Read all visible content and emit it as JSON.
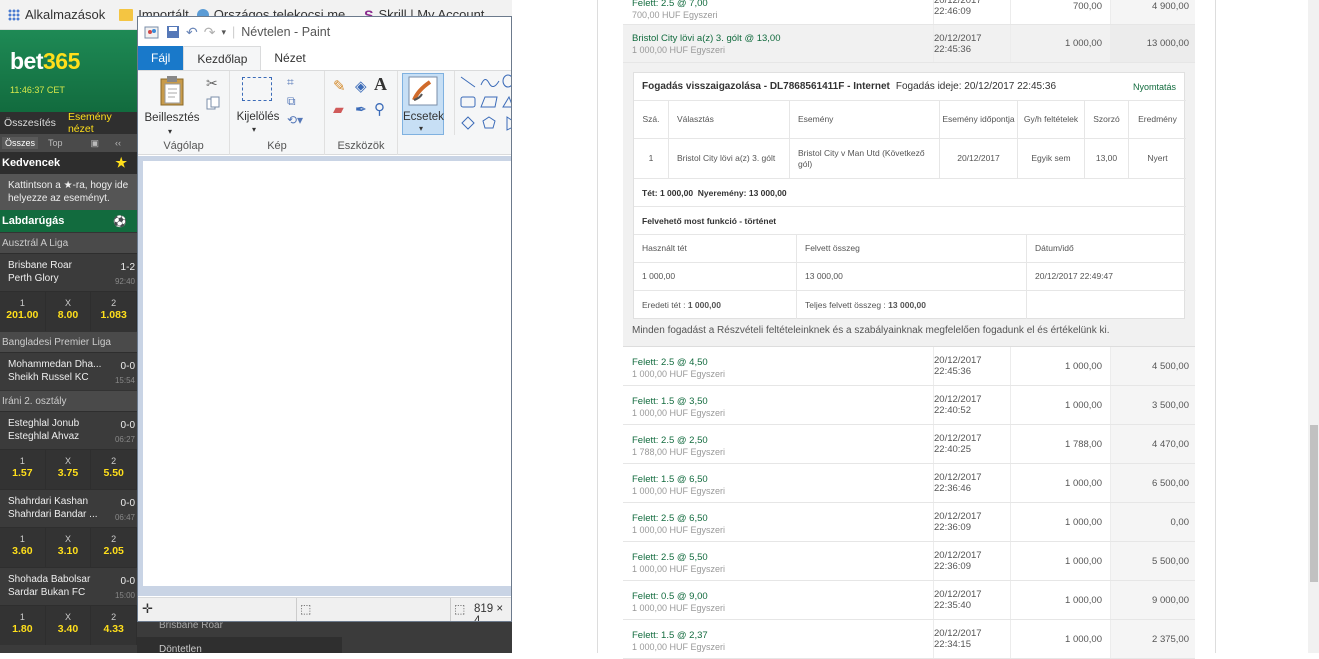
{
  "bookmarks": {
    "apps_label": "Alkalmazások",
    "items": [
      "Importált",
      "Országos telekocsi me...",
      "Skrill | My Account"
    ]
  },
  "bet365": {
    "logo_main": "bet",
    "logo_accent": "365",
    "clock": "11:46:37 CET",
    "tabs": [
      "Összesítés",
      "Esemény nézet"
    ],
    "subtabs": [
      "Összes",
      "Top"
    ],
    "favourites_title": "Kedvencek",
    "favourites_note": "Kattintson a ★-ra, hogy ide helyezze az eseményt.",
    "sport_title": "Labdarúgás",
    "leagues": [
      {
        "name": "Ausztrál A Liga",
        "matches": [
          {
            "home": "Brisbane Roar",
            "away": "Perth Glory",
            "score": "1-2",
            "time": "92:40",
            "odds": [
              {
                "label": "1",
                "value": "201.00"
              },
              {
                "label": "X",
                "value": "8.00"
              },
              {
                "label": "2",
                "value": "1.083"
              }
            ]
          }
        ]
      },
      {
        "name": "Bangladesi Premier Liga",
        "matches": [
          {
            "home": "Mohammedan Dha...",
            "away": "Sheikh Russel KC",
            "score": "0-0",
            "time": "15:54"
          }
        ]
      },
      {
        "name": "Iráni 2. osztály",
        "matches": [
          {
            "home": "Esteghlal Jonub",
            "away": "Esteghlal Ahvaz",
            "score": "0-0",
            "time": "06:27",
            "odds": [
              {
                "label": "1",
                "value": "1.57"
              },
              {
                "label": "X",
                "value": "3.75"
              },
              {
                "label": "2",
                "value": "5.50"
              }
            ]
          },
          {
            "home": "Shahrdari Kashan",
            "away": "Shahrdari Bandar ...",
            "score": "0-0",
            "time": "06:47",
            "odds": [
              {
                "label": "1",
                "value": "3.60"
              },
              {
                "label": "X",
                "value": "3.10"
              },
              {
                "label": "2",
                "value": "2.05"
              }
            ]
          },
          {
            "home": "Shohada Babolsar",
            "away": "Sardar Bukan FC",
            "score": "0-0",
            "time": "15:00",
            "odds": [
              {
                "label": "1",
                "value": "1.80"
              },
              {
                "label": "X",
                "value": "3.40"
              },
              {
                "label": "2",
                "value": "4.33"
              }
            ]
          }
        ]
      }
    ],
    "bottom_items": [
      "Brisbane Roar",
      "Döntetlen"
    ]
  },
  "paint": {
    "title": "Névtelen - Paint",
    "tabs": [
      "Fájl",
      "Kezdőlap",
      "Nézet"
    ],
    "groups": {
      "clipboard": "Vágólap",
      "image": "Kép",
      "tools": "Eszközök"
    },
    "buttons": {
      "paste": "Beillesztés",
      "select": "Kijelölés",
      "brushes": "Ecsetek"
    },
    "status_size": "819 × 4"
  },
  "receipt": {
    "title": "Fogadás visszaigazolása - DL7868561411F - Internet",
    "placed_label": "Fogadás ideje: 20/12/2017 22:45:36",
    "print": "Nyomtatás",
    "columns": [
      "Szá.",
      "Választás",
      "Esemény",
      "Esemény időpontja",
      "Gy/h feltételek",
      "Szorzó",
      "Eredmény"
    ],
    "row": {
      "no": "1",
      "selection": "Bristol City lövi a(z) 3. gólt",
      "event": "Bristol City v Man Utd (Következő gól)",
      "date": "20/12/2017",
      "ew": "Egyik sem",
      "odds": "13,00",
      "result": "Nyert"
    },
    "stake_label": "Tét:",
    "stake_value": "1 000,00",
    "win_label": "Nyeremény:",
    "win_value": "13 000,00",
    "cashout_title": "Felvehető most funkció - történet",
    "cashout_cols": [
      "Használt tét",
      "Felvett összeg",
      "Dátum/idő"
    ],
    "cashout_row": [
      "1 000,00",
      "13 000,00",
      "20/12/2017 22:49:47"
    ],
    "orig_stake_label": "Eredeti tét :",
    "orig_stake_value": "1 000,00",
    "total_label": "Teljes felvett összeg :",
    "total_value": "13 000,00",
    "footer": "Minden fogadást a Részvételi feltételeinknek és a szabályainknak megfelelően fogadunk el és értékelünk ki."
  },
  "history": {
    "top_rows": [
      {
        "sel": "Felett: 2.5 @ 7,00",
        "sub": "700,00 HUF Egyszeri",
        "date": "20/12/2017 22:46:09",
        "stake": "700,00",
        "ret": "4 900,00"
      },
      {
        "sel": "Bristol City lövi a(z) 3. gólt @ 13,00",
        "sub": "1 000,00 HUF Egyszeri",
        "date": "20/12/2017 22:45:36",
        "stake": "1 000,00",
        "ret": "13 000,00"
      }
    ],
    "rows": [
      {
        "sel": "Felett: 2.5 @ 4,50",
        "sub": "1 000,00 HUF Egyszeri",
        "date": "20/12/2017 22:45:36",
        "stake": "1 000,00",
        "ret": "4 500,00"
      },
      {
        "sel": "Felett: 1.5 @ 3,50",
        "sub": "1 000,00 HUF Egyszeri",
        "date": "20/12/2017 22:40:52",
        "stake": "1 000,00",
        "ret": "3 500,00"
      },
      {
        "sel": "Felett: 2.5 @ 2,50",
        "sub": "1 788,00 HUF Egyszeri",
        "date": "20/12/2017 22:40:25",
        "stake": "1 788,00",
        "ret": "4 470,00"
      },
      {
        "sel": "Felett: 1.5 @ 6,50",
        "sub": "1 000,00 HUF Egyszeri",
        "date": "20/12/2017 22:36:46",
        "stake": "1 000,00",
        "ret": "6 500,00"
      },
      {
        "sel": "Felett: 2.5 @ 6,50",
        "sub": "1 000,00 HUF Egyszeri",
        "date": "20/12/2017 22:36:09",
        "stake": "1 000,00",
        "ret": "0,00"
      },
      {
        "sel": "Felett: 2.5 @ 5,50",
        "sub": "1 000,00 HUF Egyszeri",
        "date": "20/12/2017 22:36:09",
        "stake": "1 000,00",
        "ret": "5 500,00"
      },
      {
        "sel": "Felett: 0.5 @ 9,00",
        "sub": "1 000,00 HUF Egyszeri",
        "date": "20/12/2017 22:35:40",
        "stake": "1 000,00",
        "ret": "9 000,00"
      },
      {
        "sel": "Felett: 1.5 @ 2,37",
        "sub": "1 000,00 HUF Egyszeri",
        "date": "20/12/2017 22:34:15",
        "stake": "1 000,00",
        "ret": "2 375,00"
      }
    ]
  }
}
